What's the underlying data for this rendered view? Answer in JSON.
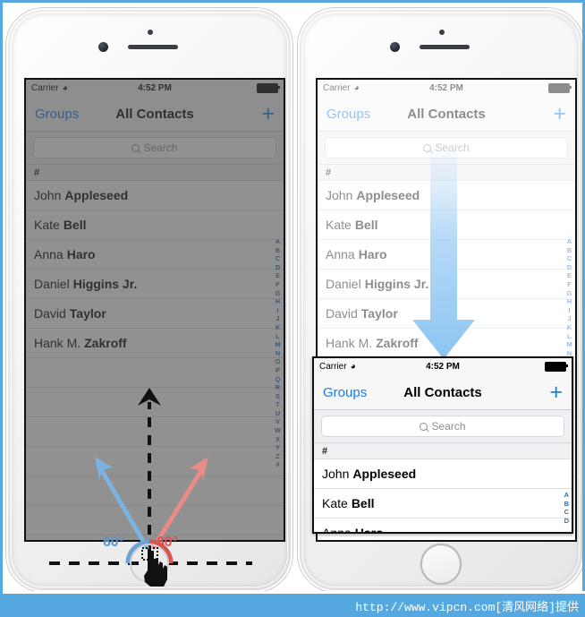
{
  "statusbar": {
    "carrier": "Carrier",
    "wifi_icon": "wifi-icon",
    "time": "4:52 PM",
    "battery_icon": "battery-full-icon"
  },
  "navbar": {
    "back_label": "Groups",
    "title": "All Contacts",
    "add_label": "+"
  },
  "search": {
    "placeholder": "Search",
    "icon": "search-icon"
  },
  "list": {
    "section_header": "#",
    "contacts": [
      {
        "first": "John",
        "last": "Appleseed"
      },
      {
        "first": "Kate",
        "last": "Bell"
      },
      {
        "first": "Anna",
        "last": "Haro"
      },
      {
        "first": "Daniel",
        "last": "Higgins Jr."
      },
      {
        "first": "David",
        "last": "Taylor"
      },
      {
        "first": "Hank M.",
        "last": "Zakroff"
      }
    ],
    "index_letters": [
      "A",
      "B",
      "C",
      "D",
      "E",
      "F",
      "G",
      "H",
      "I",
      "J",
      "K",
      "L",
      "M",
      "N",
      "O",
      "P",
      "Q",
      "R",
      "S",
      "T",
      "U",
      "V",
      "W",
      "X",
      "Y",
      "Z",
      "#"
    ],
    "inset_index_letters": [
      "A",
      "B",
      "C",
      "D"
    ]
  },
  "inset_list": {
    "section_header": "#",
    "contacts": [
      {
        "first": "John",
        "last": "Appleseed"
      },
      {
        "first": "Kate",
        "last": "Bell"
      },
      {
        "first": "Anna",
        "last": "Haro"
      }
    ]
  },
  "annotation": {
    "angle_left": "60°",
    "angle_right": "60°",
    "up_arrow": "up-arrow-icon",
    "left_arrow": "left-diagonal-arrow-icon",
    "right_arrow": "right-diagonal-arrow-icon",
    "hand_cursor": "hand-cursor-icon",
    "swipe_down_arrow": "down-arrow-icon",
    "colors": {
      "blue": "#5b92d0",
      "red": "#d9534f",
      "black": "#111111",
      "swipe_blue": "#8dc5f2",
      "accent": "#1a7ce8",
      "frame_blue": "#55a9e0"
    }
  },
  "footer": {
    "watermark": "http://www.vipcn.com[清风网络]提供"
  }
}
